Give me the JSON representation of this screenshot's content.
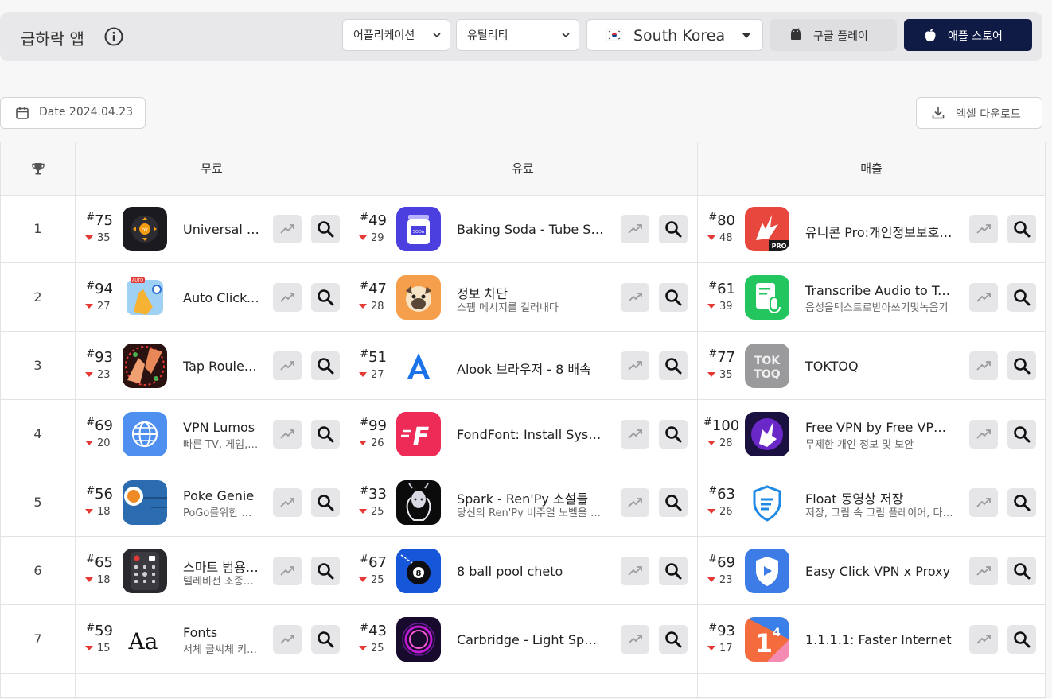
{
  "header": {
    "title": "급하락 앱",
    "category": "어플리케이션",
    "subcategory": "유틸리티",
    "country": "South Korea",
    "google_play": "구글 플레이",
    "app_store": "애플 스토어"
  },
  "toolbar": {
    "date_label": "Date 2024.04.23",
    "excel_label": "엑셀 다운로드"
  },
  "table": {
    "columns": [
      "무료",
      "유료",
      "매출"
    ],
    "rows": [
      {
        "rank": "1",
        "cells": [
          {
            "pos": "75",
            "change": "35",
            "name": "Universal TV Remote Control",
            "sub": "",
            "icon": "remote-icon"
          },
          {
            "pos": "49",
            "change": "29",
            "name": "Baking Soda - Tube Sorting",
            "sub": "",
            "icon": "soda-jar-icon"
          },
          {
            "pos": "80",
            "change": "48",
            "name": "유니콘 Pro:개인정보보호 및 광고차단",
            "sub": "",
            "icon": "unicorn-pro-icon"
          }
        ]
      },
      {
        "rank": "2",
        "cells": [
          {
            "pos": "94",
            "change": "27",
            "name": "Auto Clicker - Tapper",
            "sub": "",
            "icon": "auto-clicker-icon"
          },
          {
            "pos": "47",
            "change": "28",
            "name": "정보 차단",
            "sub": "스팸 메시지를 걸러내다",
            "icon": "pug-icon"
          },
          {
            "pos": "61",
            "change": "39",
            "name": "Transcribe Audio to Text",
            "sub": "음성을텍스트로받아쓰기및녹음기",
            "icon": "transcribe-icon"
          }
        ]
      },
      {
        "rank": "3",
        "cells": [
          {
            "pos": "93",
            "change": "23",
            "name": "Tap Roulette",
            "sub": "",
            "icon": "tap-roulette-icon"
          },
          {
            "pos": "51",
            "change": "27",
            "name": "Alook 브라우저 - 8 배속",
            "sub": "",
            "icon": "alook-icon"
          },
          {
            "pos": "77",
            "change": "35",
            "name": "TOKTOQ",
            "sub": "",
            "icon": "toktoq-icon"
          }
        ]
      },
      {
        "rank": "4",
        "cells": [
          {
            "pos": "69",
            "change": "20",
            "name": "VPN Lumos",
            "sub": "빠른 TV, 게임, 스트리밍",
            "icon": "globe-icon"
          },
          {
            "pos": "99",
            "change": "26",
            "name": "FondFont: Install System Fonts",
            "sub": "",
            "icon": "fondfont-icon"
          },
          {
            "pos": "100",
            "change": "28",
            "name": "Free VPN by Free VPN .org",
            "sub": "무제한 개인 정보 및 보안",
            "icon": "unicorn-vpn-icon"
          }
        ]
      },
      {
        "rank": "5",
        "cells": [
          {
            "pos": "56",
            "change": "18",
            "name": "Poke Genie",
            "sub": "PoGo를위한 도우미",
            "icon": "poke-genie-icon"
          },
          {
            "pos": "33",
            "change": "25",
            "name": "Spark - Ren'Py 소설들",
            "sub": "당신의 Ren'Py 비주얼 노벨을 위한",
            "icon": "spark-icon"
          },
          {
            "pos": "63",
            "change": "26",
            "name": "Float 동영상 저장",
            "sub": "저장, 그림 속 그림 플레이어, 다운로드",
            "icon": "float-shield-icon"
          }
        ]
      },
      {
        "rank": "6",
        "cells": [
          {
            "pos": "65",
            "change": "18",
            "name": "스마트 범용 리모컨",
            "sub": "텔레비전 조종하기",
            "icon": "tv-remote-icon"
          },
          {
            "pos": "67",
            "change": "25",
            "name": "8 ball pool cheto",
            "sub": "",
            "icon": "eight-ball-icon"
          },
          {
            "pos": "69",
            "change": "23",
            "name": "Easy Click VPN x Proxy",
            "sub": "",
            "icon": "vpn-shield-icon"
          }
        ]
      },
      {
        "rank": "7",
        "cells": [
          {
            "pos": "59",
            "change": "15",
            "name": "Fonts",
            "sub": "서체 글씨체 키보드",
            "icon": "fonts-aa-icon"
          },
          {
            "pos": "43",
            "change": "25",
            "name": "Carbridge - Light Speed",
            "sub": "",
            "icon": "carbridge-icon"
          },
          {
            "pos": "93",
            "change": "17",
            "name": "1.1.1.1: Faster Internet",
            "sub": "",
            "icon": "one-one-icon"
          }
        ]
      }
    ]
  }
}
